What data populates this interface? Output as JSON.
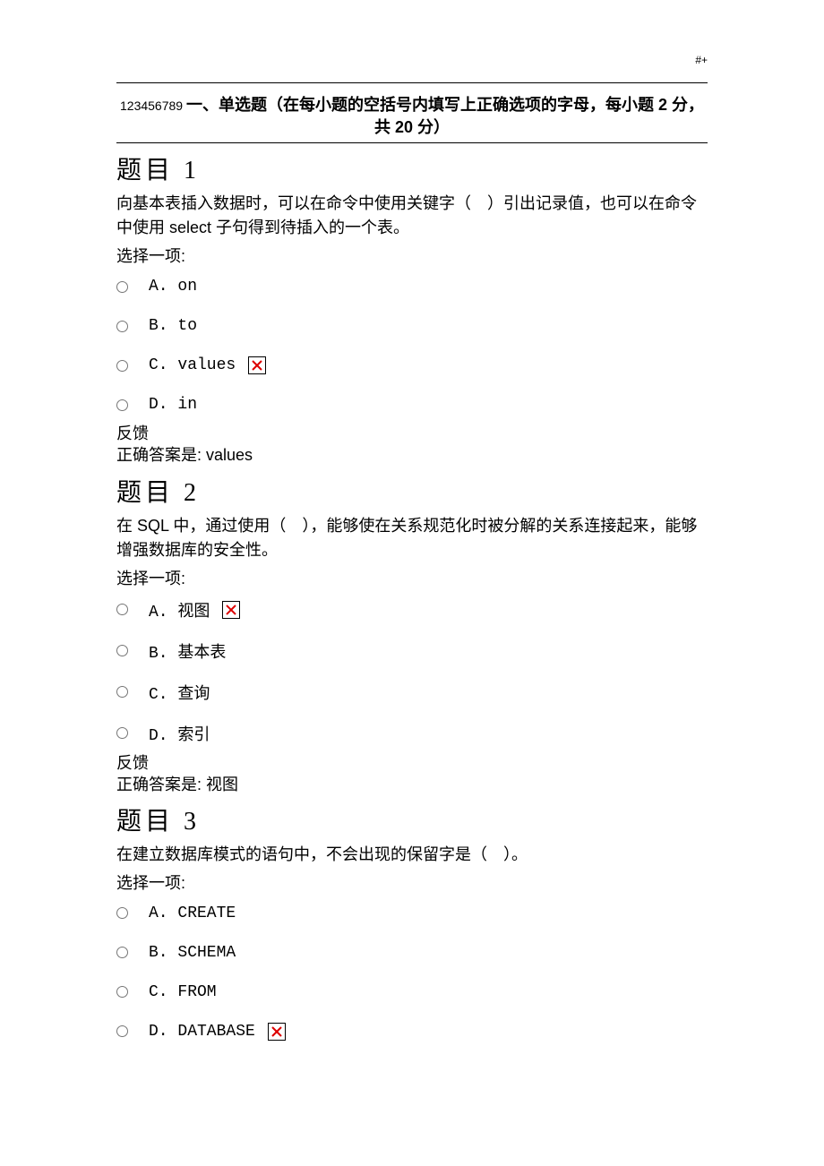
{
  "header_marker": "#+",
  "section": {
    "prefix": "123456789 ",
    "title_line1": "一、单选题（在每小题的空括号内填写上正确选项的字母，每小题 2 分，",
    "title_line2": "共 20 分）"
  },
  "questions": [
    {
      "heading": "题目 1",
      "text": "向基本表插入数据时，可以在命令中使用关键字（　）引出记录值，也可以在命令中使用 select 子句得到待插入的一个表。",
      "select_prompt": "选择一项:",
      "options": [
        {
          "label": "A. on",
          "marked": false
        },
        {
          "label": "B. to",
          "marked": false
        },
        {
          "label": "C. values",
          "marked": true
        },
        {
          "label": "D. in",
          "marked": false
        }
      ],
      "feedback_label": "反馈",
      "feedback_answer": "正确答案是: values"
    },
    {
      "heading": "题目 2",
      "text": "在 SQL 中，通过使用（　），能够使在关系规范化时被分解的关系连接起来，能够增强数据库的安全性。",
      "select_prompt": "选择一项:",
      "options": [
        {
          "label": "A. 视图",
          "marked": true
        },
        {
          "label": "B. 基本表",
          "marked": false
        },
        {
          "label": "C. 查询",
          "marked": false
        },
        {
          "label": "D. 索引",
          "marked": false
        }
      ],
      "feedback_label": "反馈",
      "feedback_answer": "正确答案是: 视图"
    },
    {
      "heading": "题目 3",
      "text": "在建立数据库模式的语句中，不会出现的保留字是（　）。",
      "select_prompt": "选择一项:",
      "options": [
        {
          "label": "A. CREATE",
          "marked": false
        },
        {
          "label": "B. SCHEMA",
          "marked": false
        },
        {
          "label": "C. FROM",
          "marked": false
        },
        {
          "label": "D. DATABASE",
          "marked": true
        }
      ],
      "feedback_label": "",
      "feedback_answer": ""
    }
  ]
}
